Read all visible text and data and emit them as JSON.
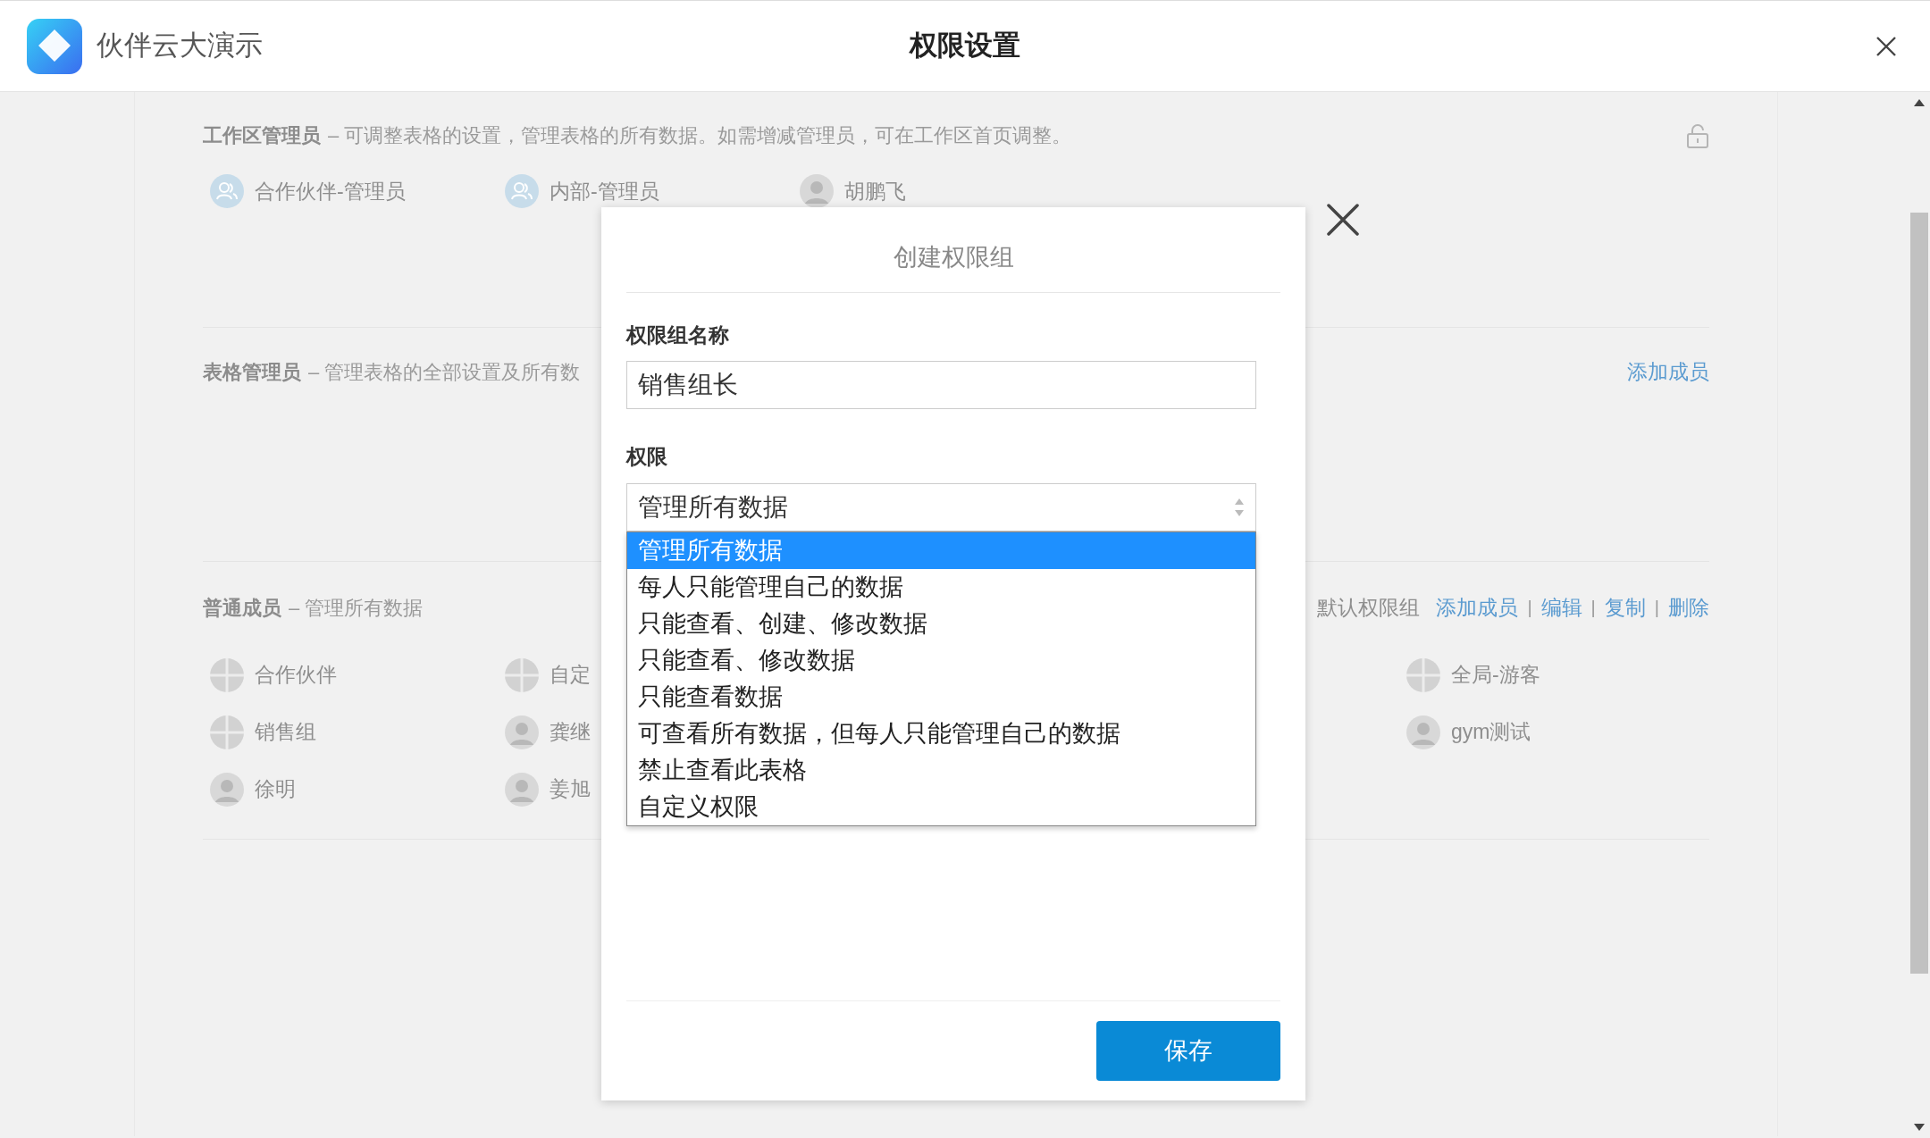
{
  "app": {
    "name": "伙伴云大演示"
  },
  "window": {
    "title": "权限设置"
  },
  "sections": [
    {
      "title": "工作区管理员",
      "description": "– 可调整表格的设置，管理表格的所有数据。如需增减管理员，可在工作区首页调整。",
      "locked": true,
      "member_rows": [
        {
          "left": [
            {
              "name": "合作伙伴-管理员",
              "kind": "group"
            },
            {
              "name": "内部-管理员",
              "kind": "group"
            },
            {
              "name": "胡鹏飞",
              "kind": "person"
            }
          ]
        }
      ]
    },
    {
      "title": "表格管理员",
      "description": "– 管理表格的全部设置及所有数",
      "locked": false,
      "links": [
        "添加成员"
      ]
    },
    {
      "title": "普通成员",
      "description": "– 管理所有数据",
      "locked": false,
      "tag": "默认权限组",
      "links": [
        "添加成员",
        "编辑",
        "复制",
        "删除"
      ],
      "separator": "|",
      "member_rows": [
        {
          "left": [
            {
              "name": "合作伙伴",
              "kind": "role"
            },
            {
              "name": "自定",
              "kind": "role"
            }
          ],
          "right": [
            {
              "name": "全局-游客",
              "kind": "role"
            }
          ]
        },
        {
          "left": [
            {
              "name": "销售组",
              "kind": "role"
            },
            {
              "name": "龚继",
              "kind": "person"
            }
          ],
          "right": [
            {
              "name": "gym测试",
              "kind": "person"
            }
          ]
        },
        {
          "left": [
            {
              "name": "徐明",
              "kind": "person"
            },
            {
              "name": "姜旭",
              "kind": "person"
            }
          ]
        }
      ]
    }
  ],
  "dialog": {
    "title": "创建权限组",
    "name_label": "权限组名称",
    "name_value": "销售组长",
    "permission_label": "权限",
    "permission_value": "管理所有数据",
    "options": [
      {
        "label": "管理所有数据",
        "selected": true
      },
      {
        "label": "每人只能管理自己的数据",
        "selected": false
      },
      {
        "label": "只能查看、创建、修改数据",
        "selected": false
      },
      {
        "label": "只能查看、修改数据",
        "selected": false
      },
      {
        "label": "只能查看数据",
        "selected": false
      },
      {
        "label": "可查看所有数据，但每人只能管理自己的数据",
        "selected": false
      },
      {
        "label": "禁止查看此表格",
        "selected": false
      },
      {
        "label": "自定义权限",
        "selected": false
      }
    ],
    "save_button": "保存"
  }
}
